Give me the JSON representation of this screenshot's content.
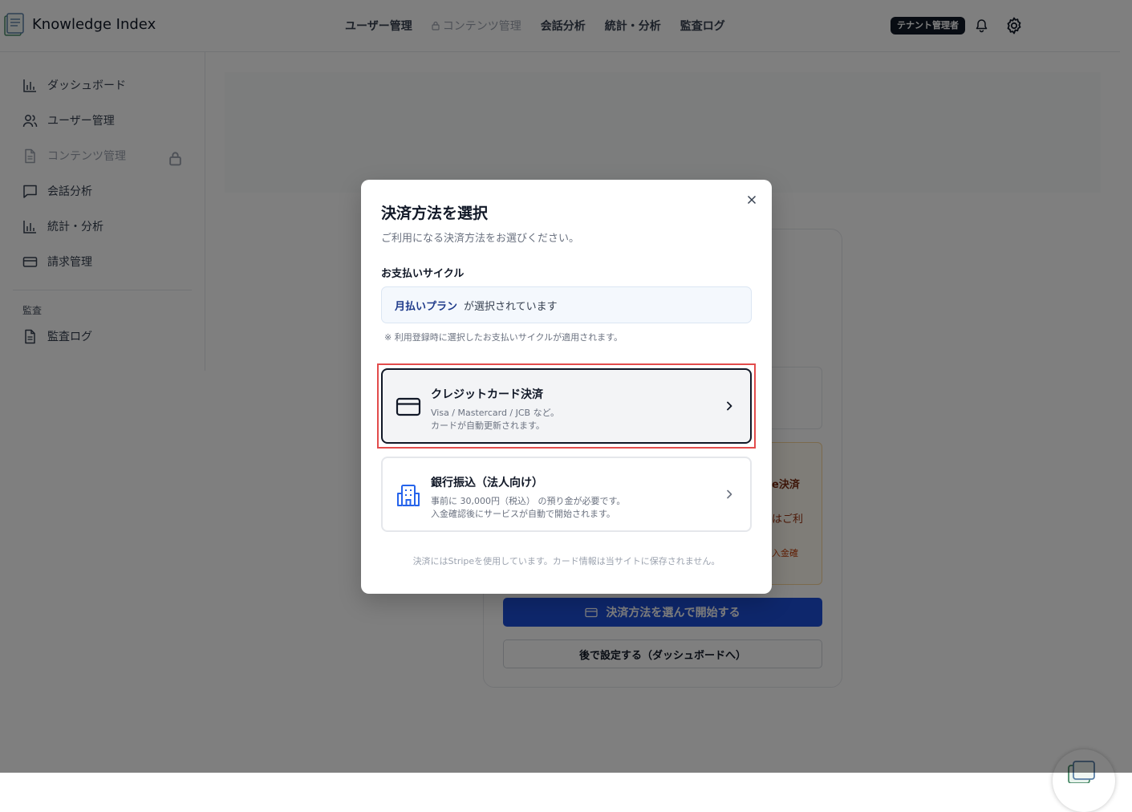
{
  "header": {
    "app_title": "Knowledge Index",
    "nav": [
      {
        "label": "ユーザー管理"
      },
      {
        "label": "コンテンツ管理"
      },
      {
        "label": "会話分析"
      },
      {
        "label": "統計・分析"
      },
      {
        "label": "監査ログ"
      }
    ],
    "role_badge": "テナント管理者"
  },
  "sidebar": {
    "items": [
      {
        "label": "ダッシュボード",
        "icon": "bar-chart-icon"
      },
      {
        "label": "ユーザー管理",
        "icon": "users-icon"
      },
      {
        "label": "コンテンツ管理",
        "icon": "document-icon"
      },
      {
        "label": "会話分析",
        "icon": "chat-icon"
      },
      {
        "label": "統計・分析",
        "icon": "bar-chart-icon"
      },
      {
        "label": "請求管理",
        "icon": "credit-card-icon"
      }
    ],
    "section_label": "監査",
    "audit_item": {
      "label": "監査ログ",
      "icon": "document-icon"
    }
  },
  "background": {
    "warn_line1": "e決済",
    "warn_line2": "はご利",
    "warn_line3": "入金確",
    "primary_button": "決済方法を選んで開始する",
    "secondary_button": "後で設定する（ダッシュボードへ）"
  },
  "modal": {
    "title": "決済方法を選択",
    "subtitle": "ご利用になる決済方法をお選びください。",
    "cycle_label": "お支払いサイクル",
    "cycle_plan": "月払いプラン",
    "cycle_suffix": "が選択されています",
    "cycle_note": "※ 利用登録時に選択したお支払いサイクルが適用されます。",
    "options": [
      {
        "title": "クレジットカード決済",
        "desc1": "Visa / Mastercard / JCB など。",
        "desc2": "カードが自動更新されます。",
        "icon": "credit-card-icon"
      },
      {
        "title": "銀行振込（法人向け）",
        "desc1": "事前に 30,000円（税込） の預り金が必要です。",
        "desc2": "入金確認後にサービスが自動で開始されます。",
        "icon": "building-icon"
      }
    ],
    "footer": "決済にはStripeを使用しています。カード情報は当サイトに保存されません。"
  },
  "colors": {
    "primary": "#1d4ed8",
    "highlight": "#e24c4c",
    "bank_icon": "#2563eb"
  }
}
